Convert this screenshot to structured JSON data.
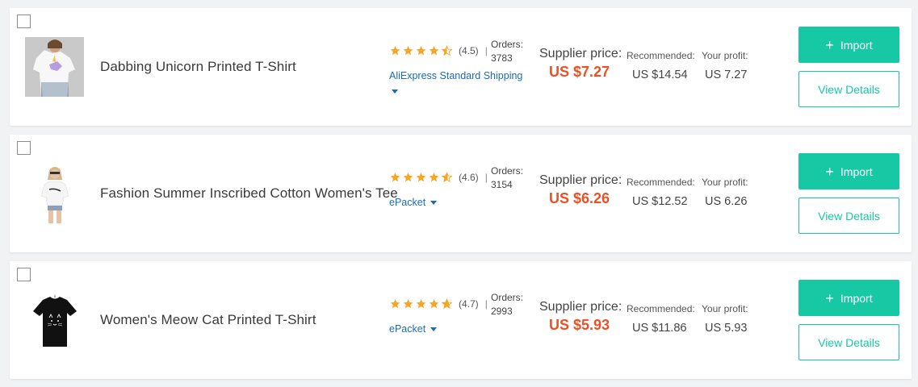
{
  "labels": {
    "orders": "Orders:",
    "supplier_price": "Supplier price:",
    "recommended": "Recommended:",
    "your_profit": "Your profit:",
    "import_button": "Import",
    "import_plus": "+",
    "view_details_button": "View Details",
    "rating_separator": "|"
  },
  "colors": {
    "accent": "#16c8a4",
    "price": "#f04e23",
    "link": "#1a6cb5",
    "star": "#f5a623"
  },
  "icons": {
    "star": "star-icon",
    "caret": "caret-down-icon",
    "plus": "plus-icon"
  },
  "products": [
    {
      "title": "Dabbing Unicorn Printed T-Shirt",
      "rating": 4.5,
      "rating_text": "(4.5)",
      "orders": "3783",
      "shipping": "AliExpress Standard Shipping",
      "supplier_price": "US $7.27",
      "recommended": "US $14.54",
      "profit": "US 7.27"
    },
    {
      "title": "Fashion Summer Inscribed Cotton Women's Tee",
      "rating": 4.6,
      "rating_text": "(4.6)",
      "orders": "3154",
      "shipping": "ePacket",
      "supplier_price": "US $6.26",
      "recommended": "US $12.52",
      "profit": "US 6.26"
    },
    {
      "title": "Women's Meow Cat Printed T-Shirt",
      "rating": 4.7,
      "rating_text": "(4.7)",
      "orders": "2993",
      "shipping": "ePacket",
      "supplier_price": "US $5.93",
      "recommended": "US $11.86",
      "profit": "US 5.93"
    }
  ]
}
